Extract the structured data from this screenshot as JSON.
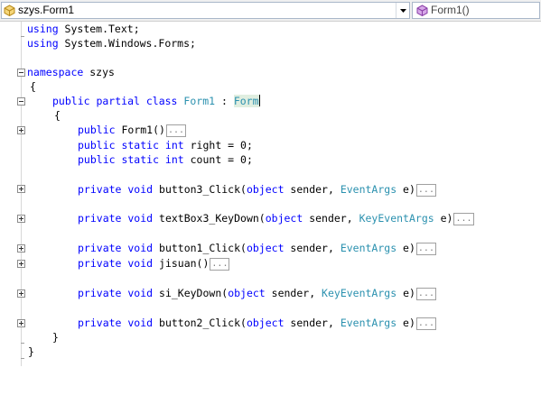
{
  "navbar": {
    "class_selector": "szys.Form1",
    "member_selector": "Form1()",
    "class_icon": "class-icon",
    "member_icon": "method-icon"
  },
  "code": {
    "l1": {
      "kw": "using",
      "rest": " System.Text;"
    },
    "l2": {
      "kw": "using",
      "rest": " System.Windows.Forms;"
    },
    "l3": {
      "kw": "namespace",
      "rest": " szys"
    },
    "l4": "{",
    "l5": {
      "kw": "public partial class",
      "sp": " ",
      "name": "Form1",
      "colon": " : ",
      "base": "Form"
    },
    "l6": "{",
    "l7": {
      "kw": "public",
      "rest": " Form1()",
      "collapsed": "..."
    },
    "l8": {
      "kw": "public static int",
      "rest": " right = 0;"
    },
    "l9": {
      "kw": "public static int",
      "rest": " count = 0;"
    },
    "l10": {
      "kw": "private void",
      "pre": " button3_Click(",
      "kw2": "object",
      "mid": " sender, ",
      "ty": "EventArgs",
      "post": " e)",
      "collapsed": "..."
    },
    "l11": {
      "kw": "private void",
      "pre": " textBox3_KeyDown(",
      "kw2": "object",
      "mid": " sender, ",
      "ty": "KeyEventArgs",
      "post": " e)",
      "collapsed": "..."
    },
    "l12": {
      "kw": "private void",
      "pre": " button1_Click(",
      "kw2": "object",
      "mid": " sender, ",
      "ty": "EventArgs",
      "post": " e)",
      "collapsed": "..."
    },
    "l13": {
      "kw": "private void",
      "rest": " jisuan()",
      "collapsed": "..."
    },
    "l14": {
      "kw": "private void",
      "pre": " si_KeyDown(",
      "kw2": "object",
      "mid": " sender, ",
      "ty": "KeyEventArgs",
      "post": " e)",
      "collapsed": "..."
    },
    "l15": {
      "kw": "private void",
      "pre": " button2_Click(",
      "kw2": "object",
      "mid": " sender, ",
      "ty": "EventArgs",
      "post": " e)",
      "collapsed": "..."
    },
    "l16": "}",
    "l17": "}"
  }
}
